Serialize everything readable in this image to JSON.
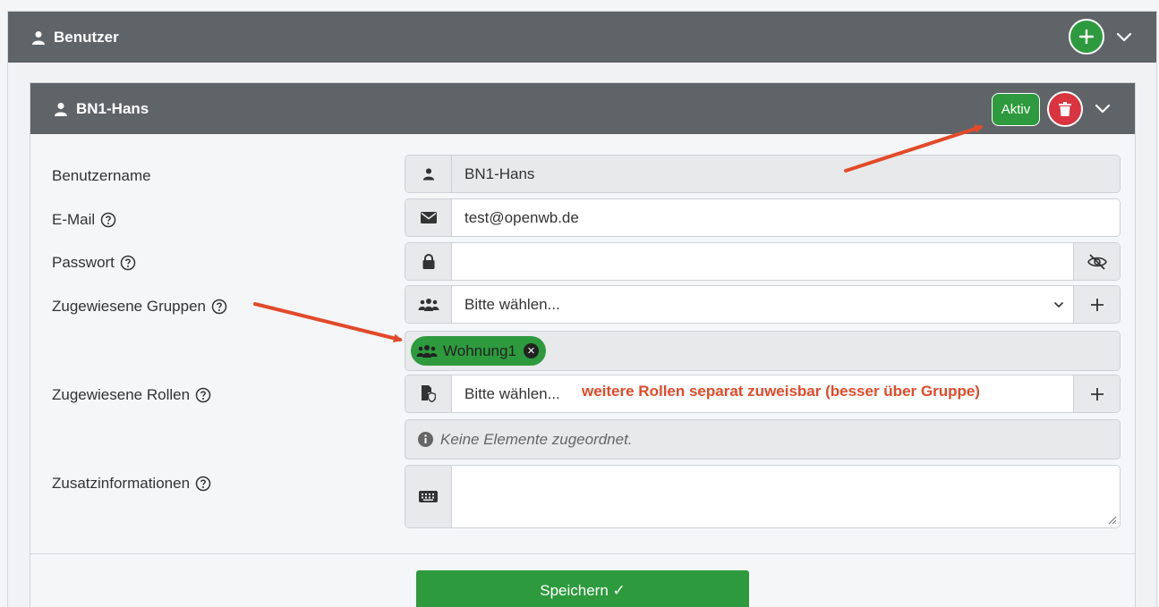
{
  "outer": {
    "title": "Benutzer",
    "add_button": "+"
  },
  "user": {
    "name": "BN1-Hans",
    "status_badge": "Aktiv"
  },
  "form": {
    "username": {
      "label": "Benutzername",
      "value": "BN1-Hans"
    },
    "email": {
      "label": "E-Mail",
      "value": "test@openwb.de"
    },
    "password": {
      "label": "Passwort",
      "value": ""
    },
    "groups": {
      "label": "Zugewiesene Gruppen",
      "placeholder": "Bitte wählen...",
      "add": "+",
      "assigned": [
        "Wohnung1"
      ]
    },
    "roles": {
      "label": "Zugewiesene Rollen",
      "placeholder": "Bitte wählen...",
      "add": "+",
      "empty_text": "Keine Elemente zugeordnet."
    },
    "extra": {
      "label": "Zusatzinformationen",
      "value": ""
    }
  },
  "save_button": "Speichern ✓",
  "annotation": {
    "roles_note": "weitere Rollen separat zuweisbar (besser über Gruppe)"
  },
  "colors": {
    "header_bg": "#5f6469",
    "success": "#2e9a3e",
    "danger": "#d9343f",
    "annotation": "#e24a2a"
  }
}
